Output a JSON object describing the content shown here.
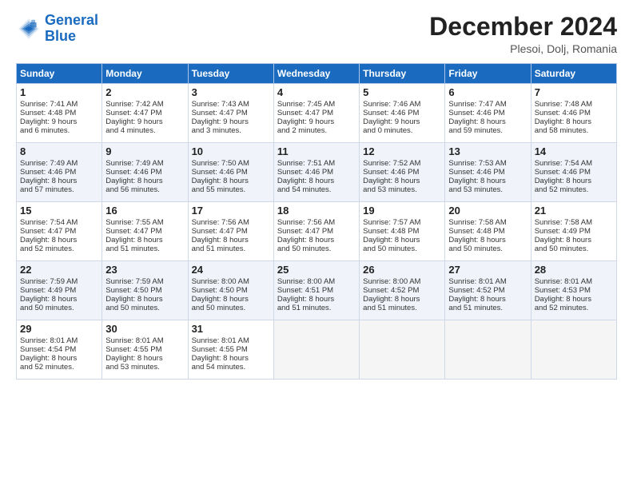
{
  "header": {
    "logo_line1": "General",
    "logo_line2": "Blue",
    "month_title": "December 2024",
    "location": "Plesoi, Dolj, Romania"
  },
  "days_of_week": [
    "Sunday",
    "Monday",
    "Tuesday",
    "Wednesday",
    "Thursday",
    "Friday",
    "Saturday"
  ],
  "weeks": [
    [
      {
        "day": "1",
        "lines": [
          "Sunrise: 7:41 AM",
          "Sunset: 4:48 PM",
          "Daylight: 9 hours",
          "and 6 minutes."
        ]
      },
      {
        "day": "2",
        "lines": [
          "Sunrise: 7:42 AM",
          "Sunset: 4:47 PM",
          "Daylight: 9 hours",
          "and 4 minutes."
        ]
      },
      {
        "day": "3",
        "lines": [
          "Sunrise: 7:43 AM",
          "Sunset: 4:47 PM",
          "Daylight: 9 hours",
          "and 3 minutes."
        ]
      },
      {
        "day": "4",
        "lines": [
          "Sunrise: 7:45 AM",
          "Sunset: 4:47 PM",
          "Daylight: 9 hours",
          "and 2 minutes."
        ]
      },
      {
        "day": "5",
        "lines": [
          "Sunrise: 7:46 AM",
          "Sunset: 4:46 PM",
          "Daylight: 9 hours",
          "and 0 minutes."
        ]
      },
      {
        "day": "6",
        "lines": [
          "Sunrise: 7:47 AM",
          "Sunset: 4:46 PM",
          "Daylight: 8 hours",
          "and 59 minutes."
        ]
      },
      {
        "day": "7",
        "lines": [
          "Sunrise: 7:48 AM",
          "Sunset: 4:46 PM",
          "Daylight: 8 hours",
          "and 58 minutes."
        ]
      }
    ],
    [
      {
        "day": "8",
        "lines": [
          "Sunrise: 7:49 AM",
          "Sunset: 4:46 PM",
          "Daylight: 8 hours",
          "and 57 minutes."
        ]
      },
      {
        "day": "9",
        "lines": [
          "Sunrise: 7:49 AM",
          "Sunset: 4:46 PM",
          "Daylight: 8 hours",
          "and 56 minutes."
        ]
      },
      {
        "day": "10",
        "lines": [
          "Sunrise: 7:50 AM",
          "Sunset: 4:46 PM",
          "Daylight: 8 hours",
          "and 55 minutes."
        ]
      },
      {
        "day": "11",
        "lines": [
          "Sunrise: 7:51 AM",
          "Sunset: 4:46 PM",
          "Daylight: 8 hours",
          "and 54 minutes."
        ]
      },
      {
        "day": "12",
        "lines": [
          "Sunrise: 7:52 AM",
          "Sunset: 4:46 PM",
          "Daylight: 8 hours",
          "and 53 minutes."
        ]
      },
      {
        "day": "13",
        "lines": [
          "Sunrise: 7:53 AM",
          "Sunset: 4:46 PM",
          "Daylight: 8 hours",
          "and 53 minutes."
        ]
      },
      {
        "day": "14",
        "lines": [
          "Sunrise: 7:54 AM",
          "Sunset: 4:46 PM",
          "Daylight: 8 hours",
          "and 52 minutes."
        ]
      }
    ],
    [
      {
        "day": "15",
        "lines": [
          "Sunrise: 7:54 AM",
          "Sunset: 4:47 PM",
          "Daylight: 8 hours",
          "and 52 minutes."
        ]
      },
      {
        "day": "16",
        "lines": [
          "Sunrise: 7:55 AM",
          "Sunset: 4:47 PM",
          "Daylight: 8 hours",
          "and 51 minutes."
        ]
      },
      {
        "day": "17",
        "lines": [
          "Sunrise: 7:56 AM",
          "Sunset: 4:47 PM",
          "Daylight: 8 hours",
          "and 51 minutes."
        ]
      },
      {
        "day": "18",
        "lines": [
          "Sunrise: 7:56 AM",
          "Sunset: 4:47 PM",
          "Daylight: 8 hours",
          "and 50 minutes."
        ]
      },
      {
        "day": "19",
        "lines": [
          "Sunrise: 7:57 AM",
          "Sunset: 4:48 PM",
          "Daylight: 8 hours",
          "and 50 minutes."
        ]
      },
      {
        "day": "20",
        "lines": [
          "Sunrise: 7:58 AM",
          "Sunset: 4:48 PM",
          "Daylight: 8 hours",
          "and 50 minutes."
        ]
      },
      {
        "day": "21",
        "lines": [
          "Sunrise: 7:58 AM",
          "Sunset: 4:49 PM",
          "Daylight: 8 hours",
          "and 50 minutes."
        ]
      }
    ],
    [
      {
        "day": "22",
        "lines": [
          "Sunrise: 7:59 AM",
          "Sunset: 4:49 PM",
          "Daylight: 8 hours",
          "and 50 minutes."
        ]
      },
      {
        "day": "23",
        "lines": [
          "Sunrise: 7:59 AM",
          "Sunset: 4:50 PM",
          "Daylight: 8 hours",
          "and 50 minutes."
        ]
      },
      {
        "day": "24",
        "lines": [
          "Sunrise: 8:00 AM",
          "Sunset: 4:50 PM",
          "Daylight: 8 hours",
          "and 50 minutes."
        ]
      },
      {
        "day": "25",
        "lines": [
          "Sunrise: 8:00 AM",
          "Sunset: 4:51 PM",
          "Daylight: 8 hours",
          "and 51 minutes."
        ]
      },
      {
        "day": "26",
        "lines": [
          "Sunrise: 8:00 AM",
          "Sunset: 4:52 PM",
          "Daylight: 8 hours",
          "and 51 minutes."
        ]
      },
      {
        "day": "27",
        "lines": [
          "Sunrise: 8:01 AM",
          "Sunset: 4:52 PM",
          "Daylight: 8 hours",
          "and 51 minutes."
        ]
      },
      {
        "day": "28",
        "lines": [
          "Sunrise: 8:01 AM",
          "Sunset: 4:53 PM",
          "Daylight: 8 hours",
          "and 52 minutes."
        ]
      }
    ],
    [
      {
        "day": "29",
        "lines": [
          "Sunrise: 8:01 AM",
          "Sunset: 4:54 PM",
          "Daylight: 8 hours",
          "and 52 minutes."
        ]
      },
      {
        "day": "30",
        "lines": [
          "Sunrise: 8:01 AM",
          "Sunset: 4:55 PM",
          "Daylight: 8 hours",
          "and 53 minutes."
        ]
      },
      {
        "day": "31",
        "lines": [
          "Sunrise: 8:01 AM",
          "Sunset: 4:55 PM",
          "Daylight: 8 hours",
          "and 54 minutes."
        ]
      },
      null,
      null,
      null,
      null
    ]
  ]
}
